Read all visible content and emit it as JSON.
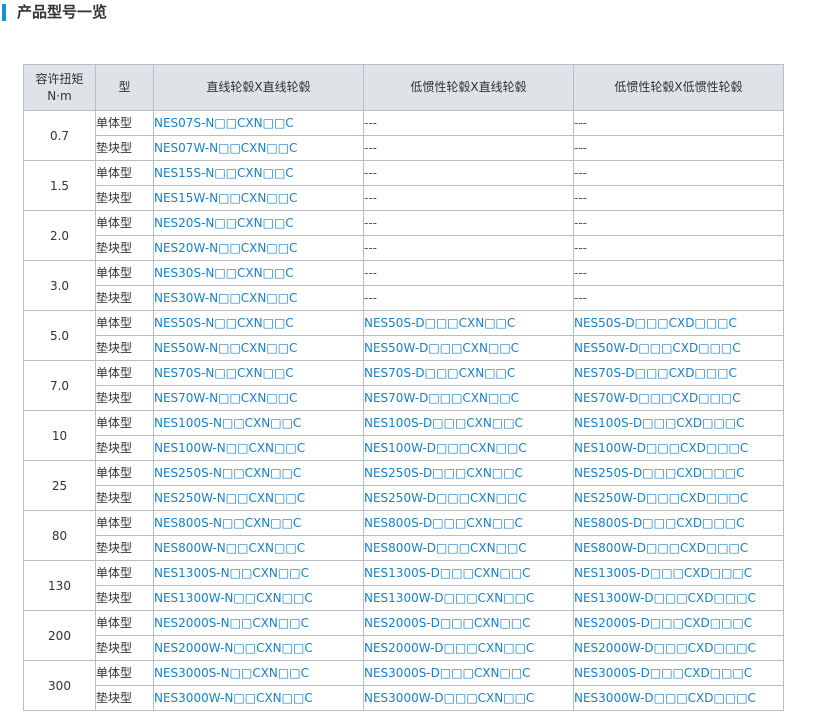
{
  "header": {
    "title": "产品型号一览"
  },
  "table": {
    "columns": [
      "容许扭矩\nN·m",
      "型",
      "直线轮毂X直线轮毂",
      "低惯性轮毂X直线轮毂",
      "低惯性轮毂X低惯性轮毂"
    ],
    "column_lines": [
      [
        "容许扭矩",
        "N·m"
      ],
      [
        "型"
      ],
      [
        "直线轮毂X直线轮毂"
      ],
      [
        "低惯性轮毂X直线轮毂"
      ],
      [
        "低惯性轮毂X低惯性轮毂"
      ]
    ],
    "groups": [
      {
        "torque": "0.7",
        "rows": [
          {
            "type": "单体型",
            "c1": "NES07S-N□□CXN□□C",
            "c2": "---",
            "c3": "---"
          },
          {
            "type": "垫块型",
            "c1": "NES07W-N□□CXN□□C",
            "c2": "---",
            "c3": "---"
          }
        ]
      },
      {
        "torque": "1.5",
        "rows": [
          {
            "type": "单体型",
            "c1": "NES15S-N□□CXN□□C",
            "c2": "---",
            "c3": "---"
          },
          {
            "type": "垫块型",
            "c1": "NES15W-N□□CXN□□C",
            "c2": "---",
            "c3": "---"
          }
        ]
      },
      {
        "torque": "2.0",
        "rows": [
          {
            "type": "单体型",
            "c1": "NES20S-N□□CXN□□C",
            "c2": "---",
            "c3": "---"
          },
          {
            "type": "垫块型",
            "c1": "NES20W-N□□CXN□□C",
            "c2": "---",
            "c3": "---"
          }
        ]
      },
      {
        "torque": "3.0",
        "rows": [
          {
            "type": "单体型",
            "c1": "NES30S-N□□CXN□□C",
            "c2": "---",
            "c3": "---"
          },
          {
            "type": "垫块型",
            "c1": "NES30W-N□□CXN□□C",
            "c2": "---",
            "c3": "---"
          }
        ]
      },
      {
        "torque": "5.0",
        "rows": [
          {
            "type": "单体型",
            "c1": "NES50S-N□□CXN□□C",
            "c2": "NES50S-D□□□CXN□□C",
            "c3": "NES50S-D□□□CXD□□□C"
          },
          {
            "type": "垫块型",
            "c1": "NES50W-N□□CXN□□C",
            "c2": "NES50W-D□□□CXN□□C",
            "c3": "NES50W-D□□□CXD□□□C"
          }
        ]
      },
      {
        "torque": "7.0",
        "rows": [
          {
            "type": "单体型",
            "c1": "NES70S-N□□CXN□□C",
            "c2": "NES70S-D□□□CXN□□C",
            "c3": "NES70S-D□□□CXD□□□C"
          },
          {
            "type": "垫块型",
            "c1": "NES70W-N□□CXN□□C",
            "c2": "NES70W-D□□□CXN□□C",
            "c3": "NES70W-D□□□CXD□□□C"
          }
        ]
      },
      {
        "torque": "10",
        "rows": [
          {
            "type": "单体型",
            "c1": "NES100S-N□□CXN□□C",
            "c2": "NES100S-D□□□CXN□□C",
            "c3": "NES100S-D□□□CXD□□□C"
          },
          {
            "type": "垫块型",
            "c1": "NES100W-N□□CXN□□C",
            "c2": "NES100W-D□□□CXN□□C",
            "c3": "NES100W-D□□□CXD□□□C"
          }
        ]
      },
      {
        "torque": "25",
        "rows": [
          {
            "type": "单体型",
            "c1": "NES250S-N□□CXN□□C",
            "c2": "NES250S-D□□□CXN□□C",
            "c3": "NES250S-D□□□CXD□□□C"
          },
          {
            "type": "垫块型",
            "c1": "NES250W-N□□CXN□□C",
            "c2": "NES250W-D□□□CXN□□C",
            "c3": "NES250W-D□□□CXD□□□C"
          }
        ]
      },
      {
        "torque": "80",
        "rows": [
          {
            "type": "单体型",
            "c1": "NES800S-N□□CXN□□C",
            "c2": "NES800S-D□□□CXN□□C",
            "c3": "NES800S-D□□□CXD□□□C"
          },
          {
            "type": "垫块型",
            "c1": "NES800W-N□□CXN□□C",
            "c2": "NES800W-D□□□CXN□□C",
            "c3": "NES800W-D□□□CXD□□□C"
          }
        ]
      },
      {
        "torque": "130",
        "rows": [
          {
            "type": "单体型",
            "c1": "NES1300S-N□□CXN□□C",
            "c2": "NES1300S-D□□□CXN□□C",
            "c3": "NES1300S-D□□□CXD□□□C"
          },
          {
            "type": "垫块型",
            "c1": "NES1300W-N□□CXN□□C",
            "c2": "NES1300W-D□□□CXN□□C",
            "c3": "NES1300W-D□□□CXD□□□C"
          }
        ]
      },
      {
        "torque": "200",
        "rows": [
          {
            "type": "单体型",
            "c1": "NES2000S-N□□CXN□□C",
            "c2": "NES2000S-D□□□CXN□□C",
            "c3": "NES2000S-D□□□CXD□□□C"
          },
          {
            "type": "垫块型",
            "c1": "NES2000W-N□□CXN□□C",
            "c2": "NES2000W-D□□□CXN□□C",
            "c3": "NES2000W-D□□□CXD□□□C"
          }
        ]
      },
      {
        "torque": "300",
        "rows": [
          {
            "type": "单体型",
            "c1": "NES3000S-N□□CXN□□C",
            "c2": "NES3000S-D□□□CXN□□C",
            "c3": "NES3000S-D□□□CXD□□□C"
          },
          {
            "type": "垫块型",
            "c1": "NES3000W-N□□CXN□□C",
            "c2": "NES3000W-D□□□CXN□□C",
            "c3": "NES3000W-D□□□CXD□□□C"
          }
        ]
      }
    ]
  },
  "colors": {
    "accent": "#1a8fd8",
    "link": "#1a7fc4",
    "header_bg": "#dfe2e7",
    "border": "#b9bdc4"
  }
}
